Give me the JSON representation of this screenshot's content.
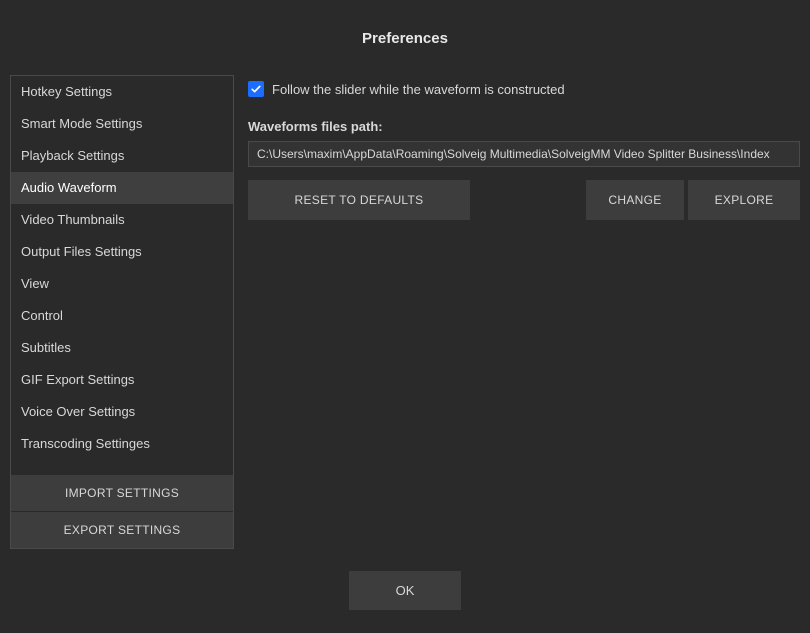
{
  "title": "Preferences",
  "sidebar": {
    "items": [
      {
        "label": "Hotkey Settings",
        "active": false
      },
      {
        "label": "Smart Mode Settings",
        "active": false
      },
      {
        "label": "Playback Settings",
        "active": false
      },
      {
        "label": "Audio Waveform",
        "active": true
      },
      {
        "label": "Video Thumbnails",
        "active": false
      },
      {
        "label": "Output Files Settings",
        "active": false
      },
      {
        "label": "View",
        "active": false
      },
      {
        "label": "Control",
        "active": false
      },
      {
        "label": "Subtitles",
        "active": false
      },
      {
        "label": "GIF Export Settings",
        "active": false
      },
      {
        "label": "Voice Over Settings",
        "active": false
      },
      {
        "label": "Transcoding Settinges",
        "active": false
      }
    ],
    "import_label": "IMPORT SETTINGS",
    "export_label": "EXPORT SETTINGS"
  },
  "main": {
    "follow_checkbox": {
      "checked": true,
      "label": "Follow the slider while the waveform is constructed"
    },
    "path_label": "Waveforms files path:",
    "path_value": "C:\\Users\\maxim\\AppData\\Roaming\\Solveig Multimedia\\SolveigMM Video Splitter Business\\Index",
    "reset_label": "RESET TO DEFAULTS",
    "change_label": "CHANGE",
    "explore_label": "EXPLORE"
  },
  "footer": {
    "ok_label": "OK"
  }
}
